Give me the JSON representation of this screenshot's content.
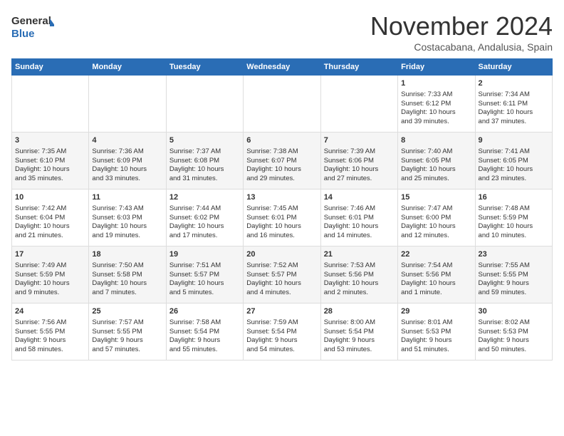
{
  "header": {
    "logo_line1": "General",
    "logo_line2": "Blue",
    "month": "November 2024",
    "location": "Costacabana, Andalusia, Spain"
  },
  "days_of_week": [
    "Sunday",
    "Monday",
    "Tuesday",
    "Wednesday",
    "Thursday",
    "Friday",
    "Saturday"
  ],
  "weeks": [
    [
      {
        "day": "",
        "info": ""
      },
      {
        "day": "",
        "info": ""
      },
      {
        "day": "",
        "info": ""
      },
      {
        "day": "",
        "info": ""
      },
      {
        "day": "",
        "info": ""
      },
      {
        "day": "1",
        "info": "Sunrise: 7:33 AM\nSunset: 6:12 PM\nDaylight: 10 hours\nand 39 minutes."
      },
      {
        "day": "2",
        "info": "Sunrise: 7:34 AM\nSunset: 6:11 PM\nDaylight: 10 hours\nand 37 minutes."
      }
    ],
    [
      {
        "day": "3",
        "info": "Sunrise: 7:35 AM\nSunset: 6:10 PM\nDaylight: 10 hours\nand 35 minutes."
      },
      {
        "day": "4",
        "info": "Sunrise: 7:36 AM\nSunset: 6:09 PM\nDaylight: 10 hours\nand 33 minutes."
      },
      {
        "day": "5",
        "info": "Sunrise: 7:37 AM\nSunset: 6:08 PM\nDaylight: 10 hours\nand 31 minutes."
      },
      {
        "day": "6",
        "info": "Sunrise: 7:38 AM\nSunset: 6:07 PM\nDaylight: 10 hours\nand 29 minutes."
      },
      {
        "day": "7",
        "info": "Sunrise: 7:39 AM\nSunset: 6:06 PM\nDaylight: 10 hours\nand 27 minutes."
      },
      {
        "day": "8",
        "info": "Sunrise: 7:40 AM\nSunset: 6:05 PM\nDaylight: 10 hours\nand 25 minutes."
      },
      {
        "day": "9",
        "info": "Sunrise: 7:41 AM\nSunset: 6:05 PM\nDaylight: 10 hours\nand 23 minutes."
      }
    ],
    [
      {
        "day": "10",
        "info": "Sunrise: 7:42 AM\nSunset: 6:04 PM\nDaylight: 10 hours\nand 21 minutes."
      },
      {
        "day": "11",
        "info": "Sunrise: 7:43 AM\nSunset: 6:03 PM\nDaylight: 10 hours\nand 19 minutes."
      },
      {
        "day": "12",
        "info": "Sunrise: 7:44 AM\nSunset: 6:02 PM\nDaylight: 10 hours\nand 17 minutes."
      },
      {
        "day": "13",
        "info": "Sunrise: 7:45 AM\nSunset: 6:01 PM\nDaylight: 10 hours\nand 16 minutes."
      },
      {
        "day": "14",
        "info": "Sunrise: 7:46 AM\nSunset: 6:01 PM\nDaylight: 10 hours\nand 14 minutes."
      },
      {
        "day": "15",
        "info": "Sunrise: 7:47 AM\nSunset: 6:00 PM\nDaylight: 10 hours\nand 12 minutes."
      },
      {
        "day": "16",
        "info": "Sunrise: 7:48 AM\nSunset: 5:59 PM\nDaylight: 10 hours\nand 10 minutes."
      }
    ],
    [
      {
        "day": "17",
        "info": "Sunrise: 7:49 AM\nSunset: 5:59 PM\nDaylight: 10 hours\nand 9 minutes."
      },
      {
        "day": "18",
        "info": "Sunrise: 7:50 AM\nSunset: 5:58 PM\nDaylight: 10 hours\nand 7 minutes."
      },
      {
        "day": "19",
        "info": "Sunrise: 7:51 AM\nSunset: 5:57 PM\nDaylight: 10 hours\nand 5 minutes."
      },
      {
        "day": "20",
        "info": "Sunrise: 7:52 AM\nSunset: 5:57 PM\nDaylight: 10 hours\nand 4 minutes."
      },
      {
        "day": "21",
        "info": "Sunrise: 7:53 AM\nSunset: 5:56 PM\nDaylight: 10 hours\nand 2 minutes."
      },
      {
        "day": "22",
        "info": "Sunrise: 7:54 AM\nSunset: 5:56 PM\nDaylight: 10 hours\nand 1 minute."
      },
      {
        "day": "23",
        "info": "Sunrise: 7:55 AM\nSunset: 5:55 PM\nDaylight: 9 hours\nand 59 minutes."
      }
    ],
    [
      {
        "day": "24",
        "info": "Sunrise: 7:56 AM\nSunset: 5:55 PM\nDaylight: 9 hours\nand 58 minutes."
      },
      {
        "day": "25",
        "info": "Sunrise: 7:57 AM\nSunset: 5:55 PM\nDaylight: 9 hours\nand 57 minutes."
      },
      {
        "day": "26",
        "info": "Sunrise: 7:58 AM\nSunset: 5:54 PM\nDaylight: 9 hours\nand 55 minutes."
      },
      {
        "day": "27",
        "info": "Sunrise: 7:59 AM\nSunset: 5:54 PM\nDaylight: 9 hours\nand 54 minutes."
      },
      {
        "day": "28",
        "info": "Sunrise: 8:00 AM\nSunset: 5:54 PM\nDaylight: 9 hours\nand 53 minutes."
      },
      {
        "day": "29",
        "info": "Sunrise: 8:01 AM\nSunset: 5:53 PM\nDaylight: 9 hours\nand 51 minutes."
      },
      {
        "day": "30",
        "info": "Sunrise: 8:02 AM\nSunset: 5:53 PM\nDaylight: 9 hours\nand 50 minutes."
      }
    ]
  ]
}
